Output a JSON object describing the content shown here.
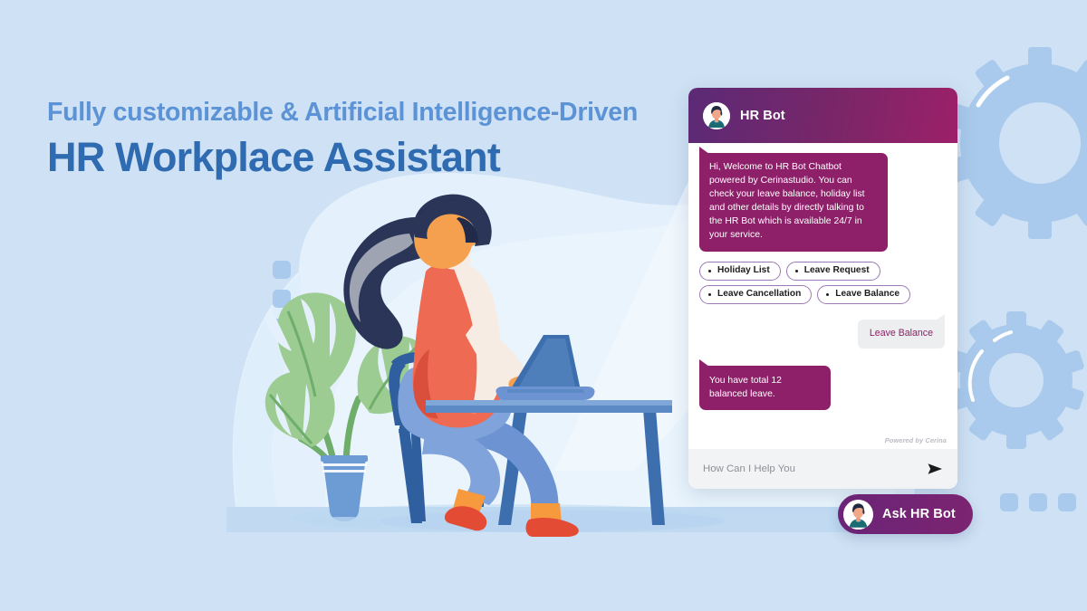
{
  "hero": {
    "subheadline": "Fully customizable & Artificial Intelligence-Driven",
    "headline": "HR Workplace Assistant",
    "sub_color": "#5b93d6",
    "headline_color": "#2f6bb0",
    "background_color": "#cfe1f4"
  },
  "chat_widget": {
    "header": {
      "title": "HR Bot",
      "avatar_icon": "hr-bot-avatar-icon",
      "gradient_start": "#5b2a76",
      "gradient_end": "#9c2069"
    },
    "messages": [
      {
        "sender": "bot",
        "text": "Hi, Welcome to HR Bot Chatbot powered by Cerinastudio. You can check your leave balance, holiday list and other details by directly talking to the HR Bot which is available 24/7 in your service.",
        "bubble_color": "#8e2069",
        "text_color": "#ffffff"
      },
      {
        "sender": "user",
        "text": "Leave Balance",
        "bubble_color": "#eceef0",
        "text_color": "#8e2069"
      },
      {
        "sender": "bot",
        "text": "You have total 12 balanced leave.",
        "bubble_color": "#8e2069",
        "text_color": "#ffffff"
      }
    ],
    "quick_replies": [
      {
        "label": "Holiday List"
      },
      {
        "label": "Leave Request"
      },
      {
        "label": "Leave Cancellation"
      },
      {
        "label": "Leave Balance"
      }
    ],
    "footer_credit": "Powered by Cerina",
    "input": {
      "placeholder": "How Can I Help You",
      "value": "",
      "send_icon": "send-arrow-icon"
    }
  },
  "ask_button": {
    "label": "Ask HR Bot",
    "avatar_icon": "hr-bot-avatar-icon",
    "color": "#6a2478"
  },
  "decorations": {
    "gear_top_icon": "gear-icon",
    "gear_bottom_icon": "gear-icon",
    "dots_left_icon": "dots-vertical-icon",
    "dots_bottom_right_icon": "dots-horizontal-icon",
    "illustration": "woman-working-on-laptop-illustration",
    "plant": "monstera-plant-illustration"
  }
}
